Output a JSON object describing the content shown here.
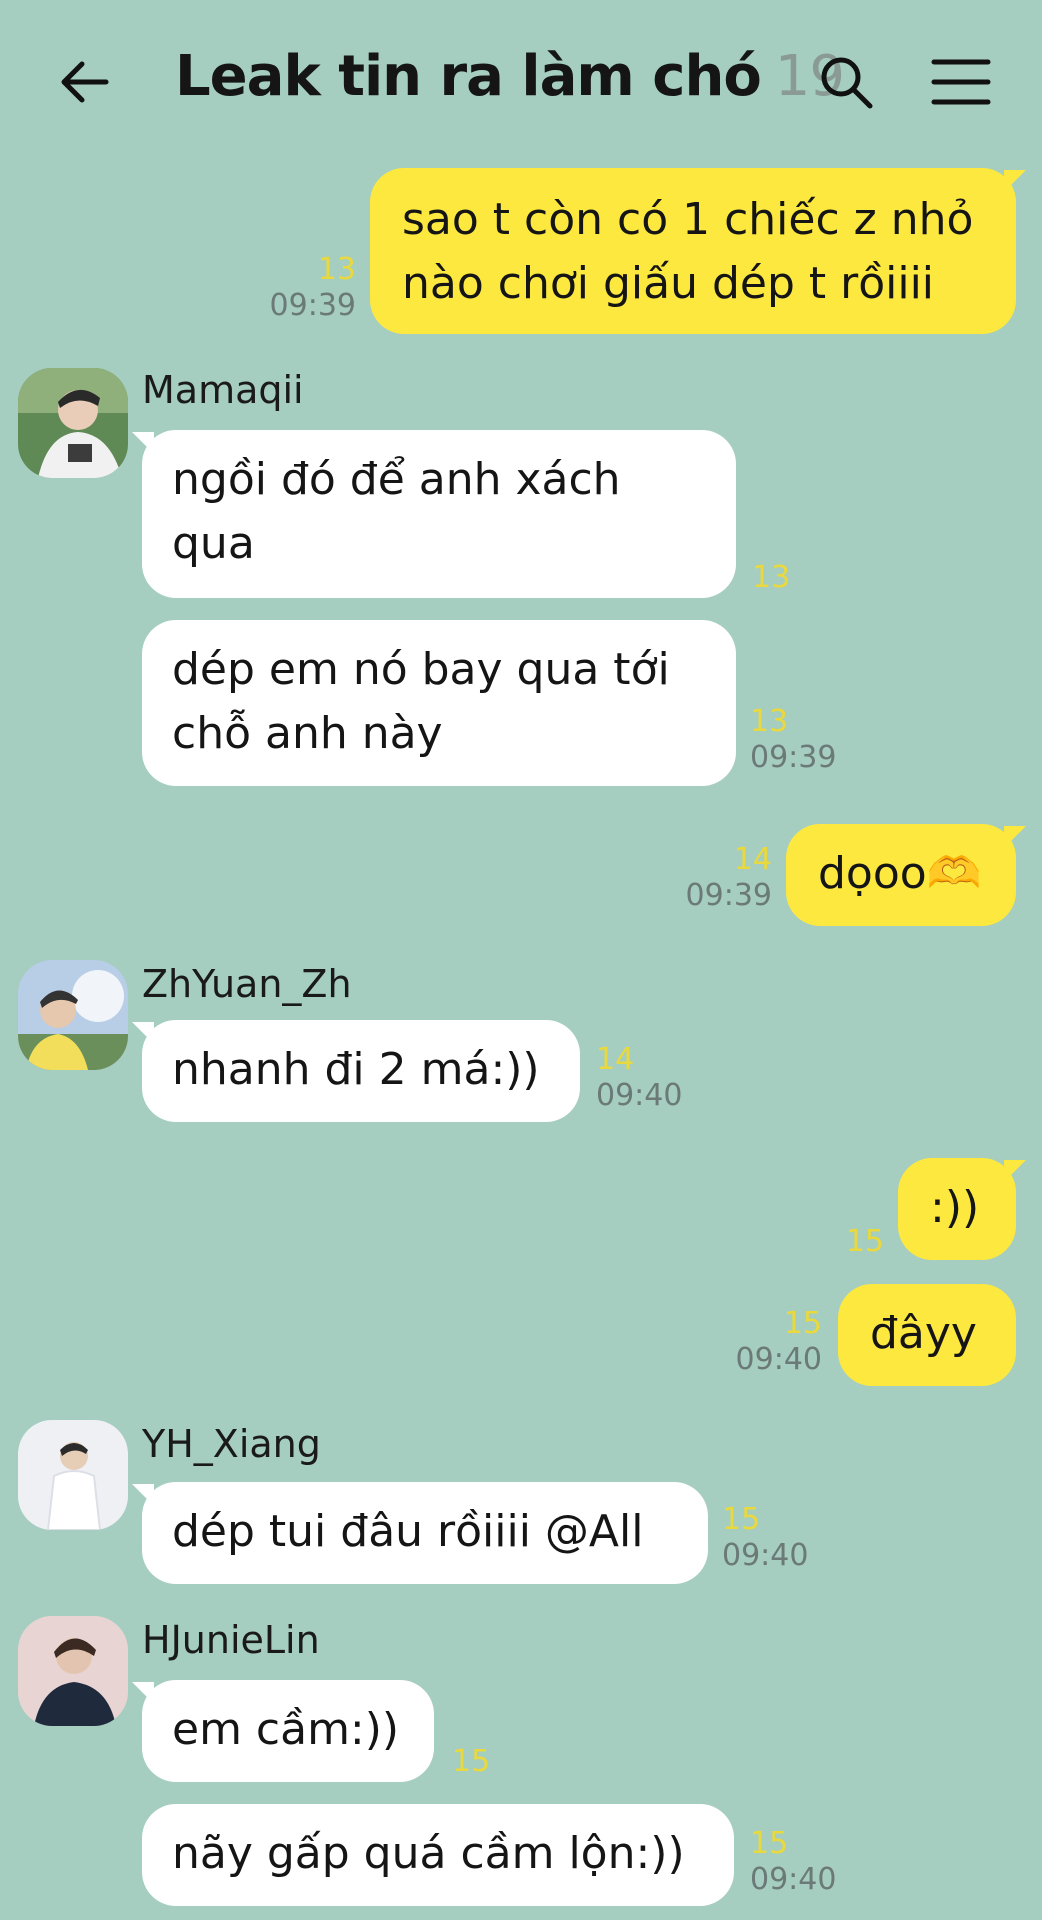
{
  "header": {
    "title": "Leak tin ra làm chó",
    "member_count": "19",
    "icons": [
      "arrow-left-icon",
      "search-icon",
      "hamburger-menu-icon"
    ]
  },
  "colors": {
    "background": "#a5cdc0",
    "my_bubble": "#fce83e",
    "other_bubble": "#ffffff",
    "unread_count": "#e9d93e",
    "timestamp": "#6b7a76"
  },
  "messages": [
    {
      "id": "m1",
      "side": "me",
      "lines": [
        "sao t còn có 1 chiếc z nhỏ",
        "nào chơi giấu dép t rồiiii"
      ],
      "count": "13",
      "time": "09:39"
    },
    {
      "id": "m2",
      "side": "other",
      "sender": "Mamaqii",
      "lines": [
        "ngồi đó để anh xách",
        "qua"
      ],
      "count": "13",
      "time": ""
    },
    {
      "id": "m3",
      "side": "other",
      "lines": [
        "dép em nó bay qua tới",
        "chỗ anh này"
      ],
      "count": "13",
      "time": "09:39"
    },
    {
      "id": "m4",
      "side": "me",
      "lines": [
        "dọoo🫶"
      ],
      "count": "14",
      "time": "09:39"
    },
    {
      "id": "m5",
      "side": "other",
      "sender": "ZhYuan_Zh",
      "lines": [
        "nhanh đi 2 má:))"
      ],
      "count": "14",
      "time": "09:40"
    },
    {
      "id": "m6",
      "side": "me",
      "lines": [
        ":))"
      ],
      "count": "15",
      "time": ""
    },
    {
      "id": "m7",
      "side": "me",
      "lines": [
        "đâyy"
      ],
      "count": "15",
      "time": "09:40"
    },
    {
      "id": "m8",
      "side": "other",
      "sender": "YH_Xiang",
      "lines": [
        "dép tui đâu rồiiii @All"
      ],
      "count": "15",
      "time": "09:40"
    },
    {
      "id": "m9",
      "side": "other",
      "sender": "HJunieLin",
      "lines": [
        "em cầm:))"
      ],
      "count": "15",
      "time": ""
    },
    {
      "id": "m10",
      "side": "other",
      "lines": [
        "nãy gấp quá cầm lộn:))"
      ],
      "count": "15",
      "time": "09:40"
    }
  ]
}
